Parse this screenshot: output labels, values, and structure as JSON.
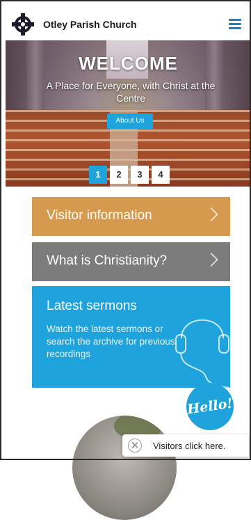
{
  "header": {
    "site_title": "Otley Parish Church",
    "logo_icon": "celtic-cross-icon",
    "menu_icon": "hamburger-menu-icon"
  },
  "hero": {
    "title": "WELCOME",
    "subtitle": "A Place for Everyone, with Christ at the Centre",
    "button_label": "About Us",
    "pages": [
      "1",
      "2",
      "3",
      "4"
    ],
    "active_page": "1"
  },
  "cards": {
    "visitor_info": "Visitor information",
    "christianity": "What is Christianity?",
    "sermons_title": "Latest sermons",
    "sermons_desc": "Watch the latest sermons or search the archive for previous recordings"
  },
  "chat": {
    "bubble_label": "Hello!",
    "visitor_prompt": "Visitors click here."
  },
  "colors": {
    "accent_blue": "#1ea3dc",
    "visitor_card": "#d59a4d",
    "christianity_card": "#7c7c7c"
  }
}
